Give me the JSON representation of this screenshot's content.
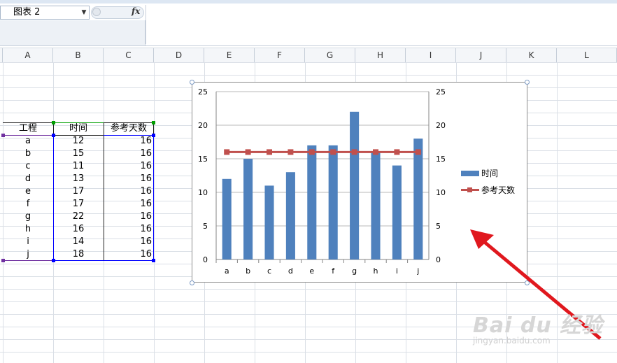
{
  "formula_bar": {
    "name_box": "图表 2",
    "dropdown_icon": "triangle-down-icon",
    "fx_label": "fx",
    "formula_value": ""
  },
  "columns": [
    "A",
    "B",
    "C",
    "D",
    "E",
    "F",
    "G",
    "H",
    "I",
    "J",
    "K",
    "L"
  ],
  "table": {
    "headers": [
      "工程",
      "时间",
      "参考天数"
    ],
    "rows": [
      [
        "a",
        "12",
        "16"
      ],
      [
        "b",
        "15",
        "16"
      ],
      [
        "c",
        "11",
        "16"
      ],
      [
        "d",
        "13",
        "16"
      ],
      [
        "e",
        "17",
        "16"
      ],
      [
        "f",
        "17",
        "16"
      ],
      [
        "g",
        "22",
        "16"
      ],
      [
        "h",
        "16",
        "16"
      ],
      [
        "i",
        "14",
        "16"
      ],
      [
        "j",
        "18",
        "16"
      ]
    ]
  },
  "chart_data": {
    "type": "bar",
    "categories": [
      "a",
      "b",
      "c",
      "d",
      "e",
      "f",
      "g",
      "h",
      "i",
      "j"
    ],
    "series": [
      {
        "name": "时间",
        "type": "bar",
        "color": "#4f81bd",
        "values": [
          12,
          15,
          11,
          13,
          17,
          17,
          22,
          16,
          14,
          18
        ]
      },
      {
        "name": "参考天数",
        "type": "line",
        "color": "#c0504d",
        "values": [
          16,
          16,
          16,
          16,
          16,
          16,
          16,
          16,
          16,
          16
        ]
      }
    ],
    "ylim": [
      0,
      25
    ],
    "yticks": [
      "0",
      "5",
      "10",
      "15",
      "20",
      "25"
    ],
    "secondary_yticks": [
      "0",
      "5",
      "10",
      "15",
      "20",
      "25"
    ],
    "grid": true,
    "legend_position": "right"
  },
  "watermark": {
    "title": "Bai du 经验",
    "subtitle": "jingyan.baidu.com"
  },
  "annotation": {
    "arrow_color": "#e0181e"
  }
}
